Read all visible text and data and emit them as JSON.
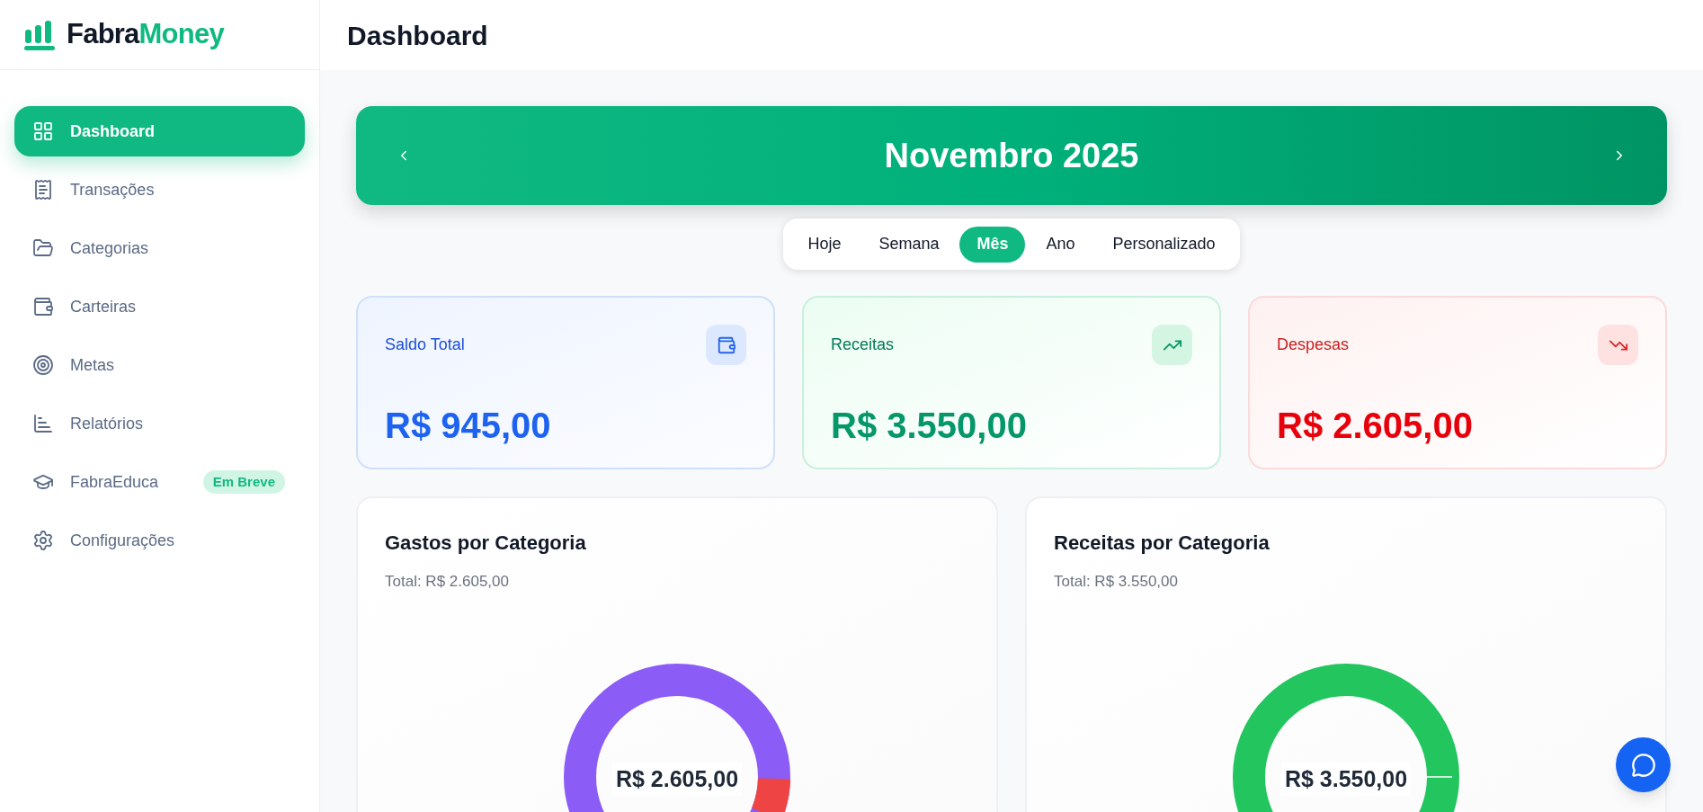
{
  "logo": {
    "first": "Fabra",
    "second": "Money"
  },
  "sidebar": {
    "items": [
      {
        "label": "Dashboard",
        "kind": "dashboard",
        "selected": true
      },
      {
        "label": "Transações",
        "kind": "receipt",
        "selected": false
      },
      {
        "label": "Categorias",
        "kind": "folder",
        "selected": false
      },
      {
        "label": "Carteiras",
        "kind": "wallet",
        "selected": false
      },
      {
        "label": "Metas",
        "kind": "target",
        "selected": false
      },
      {
        "label": "Relatórios",
        "kind": "chart",
        "selected": false
      },
      {
        "label": "FabraEduca",
        "kind": "education",
        "selected": false,
        "badge": "Em Breve"
      },
      {
        "label": "Configurações",
        "kind": "settings",
        "selected": false
      }
    ]
  },
  "header": {
    "title": "Dashboard"
  },
  "period": {
    "label": "Novembro 2025"
  },
  "ranges": [
    {
      "label": "Hoje",
      "selected": false
    },
    {
      "label": "Semana",
      "selected": false
    },
    {
      "label": "Mês",
      "selected": true
    },
    {
      "label": "Ano",
      "selected": false
    },
    {
      "label": "Personalizado",
      "selected": false
    }
  ],
  "summary": [
    {
      "kind": "balance",
      "label": "Saldo Total",
      "value": "R$ 945,00"
    },
    {
      "kind": "income",
      "label": "Receitas",
      "value": "R$ 3.550,00"
    },
    {
      "kind": "expense",
      "label": "Despesas",
      "value": "R$ 2.605,00"
    }
  ],
  "charts": [
    {
      "kind": "expense",
      "title": "Gastos por Categoria",
      "total": "Total: R$ 2.605,00",
      "center_label": "R$ 2.605,00"
    },
    {
      "kind": "income",
      "title": "Receitas por Categoria",
      "total": "Total: R$ 3.550,00",
      "center_label": "R$ 3.550,00"
    }
  ]
}
